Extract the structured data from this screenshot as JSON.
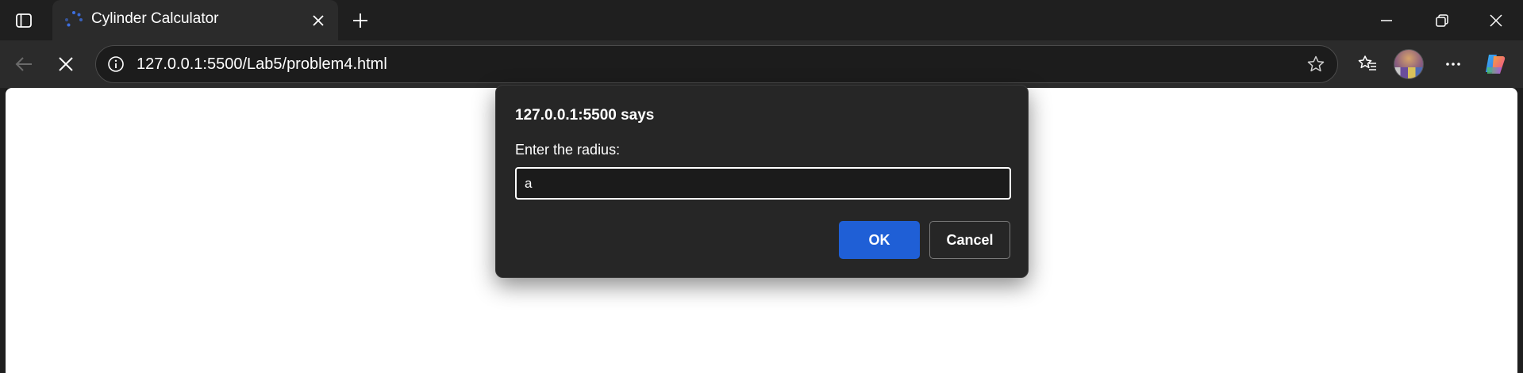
{
  "tab": {
    "title": "Cylinder Calculator",
    "favicon": "loading-spinner-icon"
  },
  "window_controls": {
    "minimize": "minimize-icon",
    "restore": "restore-icon",
    "close": "close-icon"
  },
  "toolbar": {
    "back": "back-arrow-icon",
    "stop": "stop-loading-icon",
    "favorites": "favorites-icon",
    "more": "more-icon",
    "copilot": "copilot-icon"
  },
  "address_bar": {
    "url": "127.0.0.1:5500/Lab5/problem4.html",
    "info_icon": "site-info-icon",
    "star_icon": "add-favorite-star-icon"
  },
  "dialog": {
    "title": "127.0.0.1:5500 says",
    "message": "Enter the radius:",
    "input_value": "a",
    "ok_label": "OK",
    "cancel_label": "Cancel"
  },
  "colors": {
    "accent": "#1f5fd6",
    "spinner": "#3d6fe0",
    "chrome_dark": "#1f1f1f",
    "toolbar": "#2b2b2b",
    "dialog_bg": "#262626"
  }
}
